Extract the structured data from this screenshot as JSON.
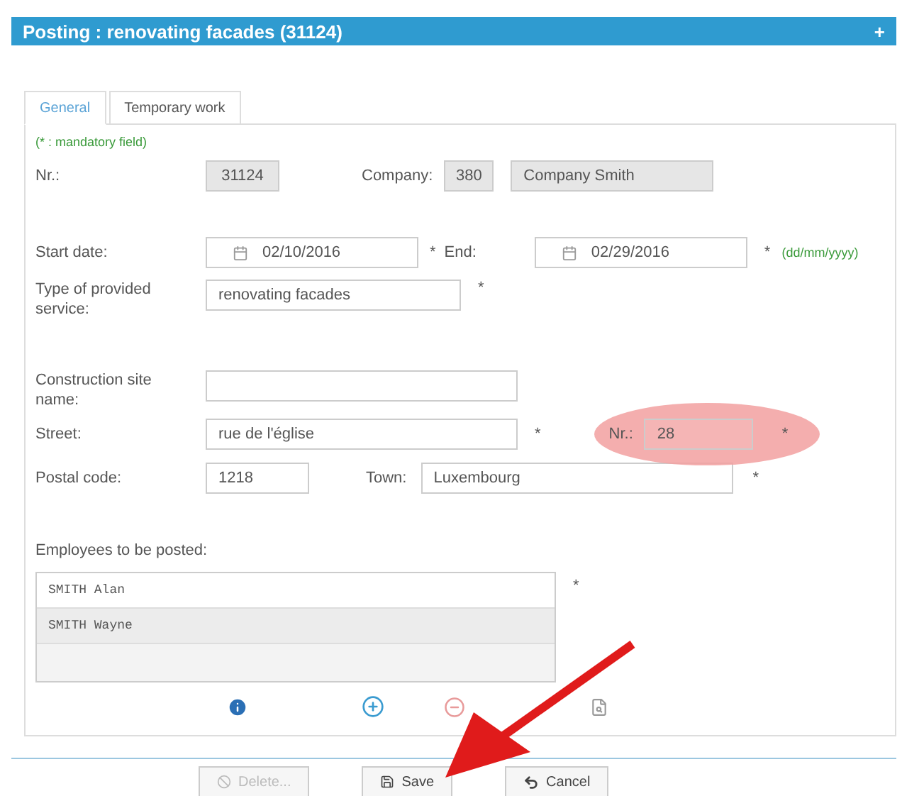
{
  "window": {
    "title": "Posting : renovating facades (31124)",
    "corner": "+"
  },
  "tabs": [
    {
      "label": "General",
      "selected": true
    },
    {
      "label": "Temporary work",
      "selected": false
    }
  ],
  "mandatory_note": "(* : mandatory field)",
  "nr": {
    "label": "Nr.:",
    "value": "31124"
  },
  "company": {
    "label": "Company:",
    "code": "380",
    "name": "Company Smith"
  },
  "start_date": {
    "label": "Start date:",
    "value": "02/10/2016",
    "required_mark": "*"
  },
  "end_date": {
    "label": "End:",
    "value": "02/29/2016",
    "required_mark": "*"
  },
  "date_format": "(dd/mm/yyyy)",
  "service": {
    "label": "Type of provided service:",
    "value": "renovating facades",
    "required_mark": "*"
  },
  "construction_site": {
    "label": "Construction site name:"
  },
  "street": {
    "label": "Street:",
    "value": "rue de l'église",
    "required_mark": "*"
  },
  "house_number": {
    "label": "Nr.:",
    "value": "28",
    "required_mark": "*",
    "highlighted": true
  },
  "postal_code": {
    "label": "Postal code:",
    "value": "1218"
  },
  "town": {
    "label": "Town:",
    "value": "Luxembourg",
    "required_mark": "*"
  },
  "employees": {
    "label": "Employees to be posted:",
    "required_mark": "*",
    "rows": [
      {
        "name": "SMITH Alan",
        "selected": false
      },
      {
        "name": "SMITH Wayne",
        "selected": true
      }
    ]
  },
  "buttons": [
    {
      "label": "Delete...",
      "disabled": true,
      "kind": "delete"
    },
    {
      "label": "Save",
      "disabled": false,
      "kind": "save"
    },
    {
      "label": "Cancel",
      "disabled": false,
      "kind": "cancel"
    }
  ]
}
